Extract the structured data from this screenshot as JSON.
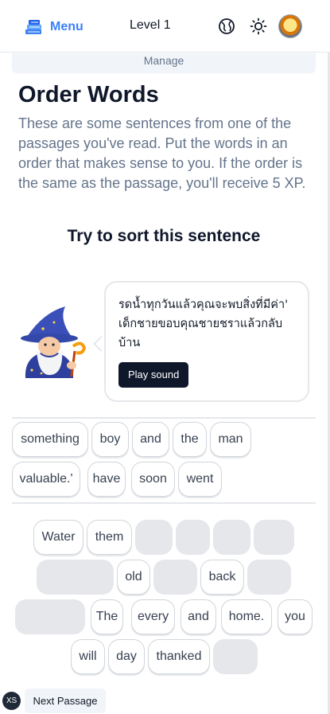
{
  "header": {
    "menu_label": "Menu",
    "level_label": "Level 1",
    "accent_color": "#3b82f6"
  },
  "manage_label": "Manage",
  "page": {
    "title": "Order Words",
    "description": "These are some sentences from one of the passages you've read. Put the words in an order that makes sense to you. If the order is the same as the passage, you'll receive 5 XP.",
    "subtitle": "Try to sort this sentence"
  },
  "bubble": {
    "sentence": "รดน้ำทุกวันแล้วคุณจะพบสิ่งที่มีค่า' เด็กชายขอบคุณชายชราแล้วกลับบ้าน",
    "play_label": "Play sound"
  },
  "answer_words": [
    "something",
    "boy",
    "and",
    "the",
    "man",
    "valuable.'",
    "have",
    "soon",
    "went"
  ],
  "pool": {
    "words": [
      "Water",
      "them",
      "old",
      "back",
      "The",
      "every",
      "and",
      "home.",
      "you",
      "will",
      "day",
      "thanked"
    ]
  },
  "footer": {
    "badge": "XS",
    "next_label": "Next Passage"
  }
}
